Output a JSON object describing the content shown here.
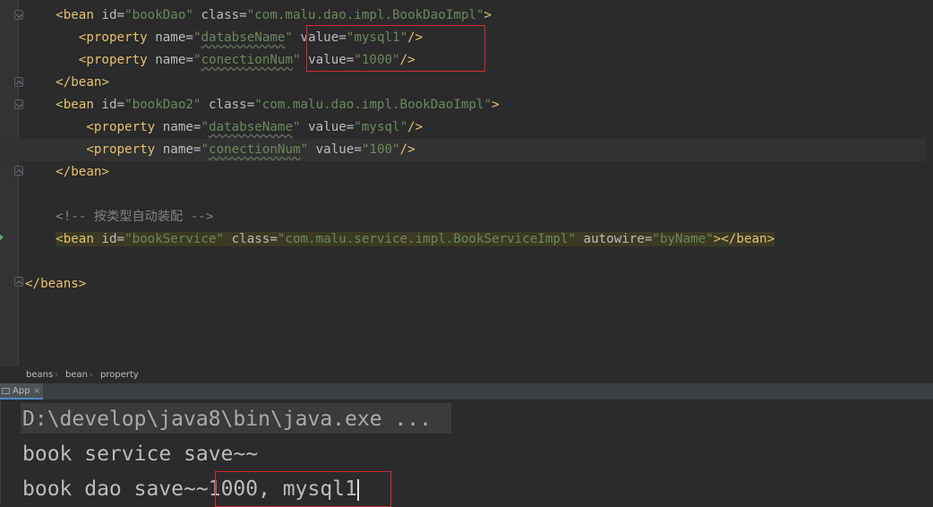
{
  "editor": {
    "lines": [
      {
        "indent": "    ",
        "parts": [
          [
            "tag",
            "<bean "
          ],
          [
            "attr",
            "id="
          ],
          [
            "val",
            "\"bookDao\""
          ],
          [
            "attr",
            " class="
          ],
          [
            "val",
            "\"com.malu.dao.impl.BookDaoImpl\""
          ],
          [
            "tag",
            ">"
          ]
        ]
      },
      {
        "indent": "       ",
        "parts": [
          [
            "tag",
            "<property "
          ],
          [
            "attr",
            "name="
          ],
          [
            "val",
            "\""
          ],
          [
            "valul",
            "databseName"
          ],
          [
            "val",
            "\""
          ],
          [
            "attr",
            " value="
          ],
          [
            "val",
            "\"mysql1\""
          ],
          [
            "tag",
            "/>"
          ]
        ]
      },
      {
        "indent": "       ",
        "parts": [
          [
            "tag",
            "<property "
          ],
          [
            "attr",
            "name="
          ],
          [
            "val",
            "\""
          ],
          [
            "valul",
            "conectionNum"
          ],
          [
            "val",
            "\""
          ],
          [
            "attr",
            " value="
          ],
          [
            "val",
            "\"1000\""
          ],
          [
            "tag",
            "/>"
          ]
        ]
      },
      {
        "indent": "    ",
        "parts": [
          [
            "tag",
            "</bean>"
          ]
        ]
      },
      {
        "indent": "    ",
        "parts": [
          [
            "tag",
            "<bean "
          ],
          [
            "attr",
            "id="
          ],
          [
            "val",
            "\"bookDao2\""
          ],
          [
            "attr",
            " class="
          ],
          [
            "val",
            "\"com.malu.dao.impl.BookDaoImpl\""
          ],
          [
            "tag",
            ">"
          ]
        ]
      },
      {
        "indent": "        ",
        "parts": [
          [
            "tag",
            "<property "
          ],
          [
            "attr",
            "name="
          ],
          [
            "val",
            "\""
          ],
          [
            "valul",
            "databseName"
          ],
          [
            "val",
            "\""
          ],
          [
            "attr",
            " value="
          ],
          [
            "val",
            "\"mysql\""
          ],
          [
            "tag",
            "/>"
          ]
        ]
      },
      {
        "indent": "        ",
        "parts": [
          [
            "tag",
            "<property "
          ],
          [
            "attr",
            "name="
          ],
          [
            "val",
            "\""
          ],
          [
            "valul",
            "conectionNum"
          ],
          [
            "val",
            "\""
          ],
          [
            "attr",
            " value="
          ],
          [
            "val",
            "\"100\""
          ],
          [
            "tag",
            "/>"
          ]
        ]
      },
      {
        "indent": "    ",
        "parts": [
          [
            "tag",
            "</bean>"
          ]
        ]
      },
      {
        "indent": "",
        "parts": []
      },
      {
        "indent": "    ",
        "parts": [
          [
            "cmt",
            "<!-- 按类型自动装配 -->"
          ]
        ]
      },
      {
        "indent": "    ",
        "parts": [
          [
            "tag",
            "<bean "
          ],
          [
            "attr",
            "id="
          ],
          [
            "val",
            "\"bookService\""
          ],
          [
            "attr",
            " class="
          ],
          [
            "val",
            "\"com.malu.service.impl.BookServiceImpl\""
          ],
          [
            "attr",
            " autowire="
          ],
          [
            "val",
            "\"byName\""
          ],
          [
            "tag",
            "></bean>"
          ]
        ]
      },
      {
        "indent": "",
        "parts": []
      },
      {
        "indent": "",
        "parts": [
          [
            "tag",
            "</beans>"
          ]
        ]
      }
    ]
  },
  "breadcrumb": [
    "beans",
    "bean",
    "property"
  ],
  "run": {
    "tab_label": "App",
    "close": "×"
  },
  "console": {
    "cmd": "D:\\develop\\java8\\bin\\java.exe ...",
    "line1": "book service save~~",
    "line2_prefix": "book dao save~~",
    "line2_value": "1000, mysql1"
  },
  "colors": {
    "tag": "#e8bf6a",
    "attr": "#bababa",
    "value": "#6a8759",
    "comment": "#808080",
    "highlight": "#d62a2a"
  }
}
